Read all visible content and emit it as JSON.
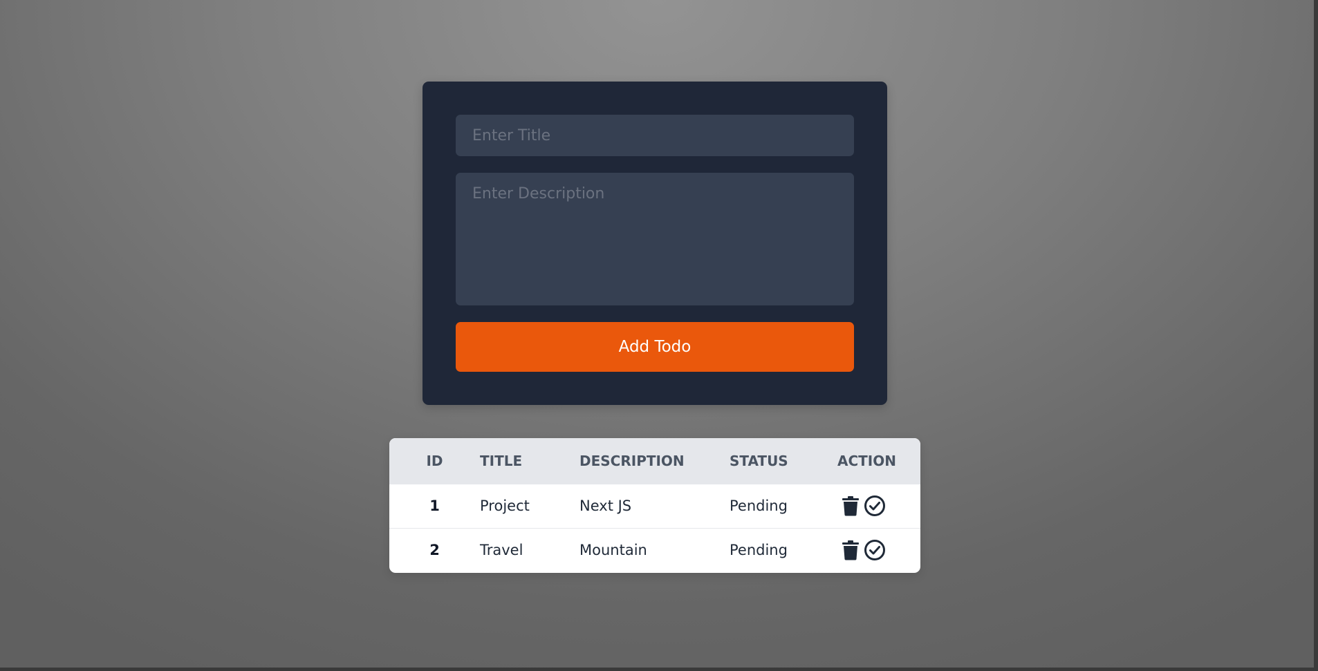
{
  "form": {
    "title_placeholder": "Enter Title",
    "title_value": "",
    "description_placeholder": "Enter Description",
    "description_value": "",
    "add_button_label": "Add Todo"
  },
  "table": {
    "headers": {
      "id": "ID",
      "title": "TITLE",
      "description": "DESCRIPTION",
      "status": "STATUS",
      "action": "ACTION"
    },
    "rows": [
      {
        "id": "1",
        "title": "Project",
        "description": "Next JS",
        "status": "Pending",
        "actions": [
          "trash-icon",
          "check-circle-icon"
        ]
      },
      {
        "id": "2",
        "title": "Travel",
        "description": "Mountain",
        "status": "Pending",
        "actions": [
          "trash-icon",
          "check-circle-icon"
        ]
      }
    ]
  },
  "colors": {
    "card_background": "#1f2738",
    "input_background": "#364052",
    "button_accent": "#ea580c",
    "table_header_background": "#e5e7eb",
    "icon_color": "#1f2937"
  }
}
